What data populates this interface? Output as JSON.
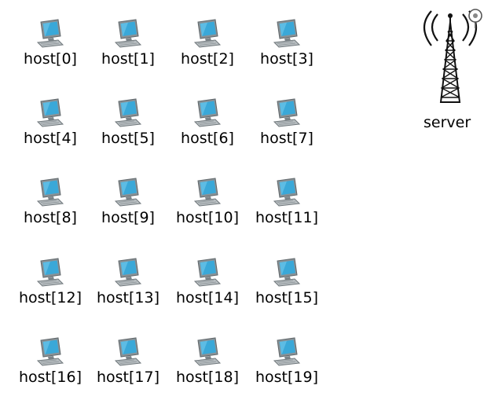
{
  "network": {
    "hosts": [
      {
        "label": "host[0]"
      },
      {
        "label": "host[1]"
      },
      {
        "label": "host[2]"
      },
      {
        "label": "host[3]"
      },
      {
        "label": "host[4]"
      },
      {
        "label": "host[5]"
      },
      {
        "label": "host[6]"
      },
      {
        "label": "host[7]"
      },
      {
        "label": "host[8]"
      },
      {
        "label": "host[9]"
      },
      {
        "label": "host[10]"
      },
      {
        "label": "host[11]"
      },
      {
        "label": "host[12]"
      },
      {
        "label": "host[13]"
      },
      {
        "label": "host[14]"
      },
      {
        "label": "host[15]"
      },
      {
        "label": "host[16]"
      },
      {
        "label": "host[17]"
      },
      {
        "label": "host[18]"
      },
      {
        "label": "host[19]"
      }
    ],
    "server": {
      "label": "server"
    }
  },
  "icons": {
    "host": "desktop-computer-icon",
    "server": "radio-tower-icon"
  },
  "colors": {
    "screen": "#3aa8d8",
    "monitor_body": "#8a9296",
    "label_text": "#000000"
  }
}
